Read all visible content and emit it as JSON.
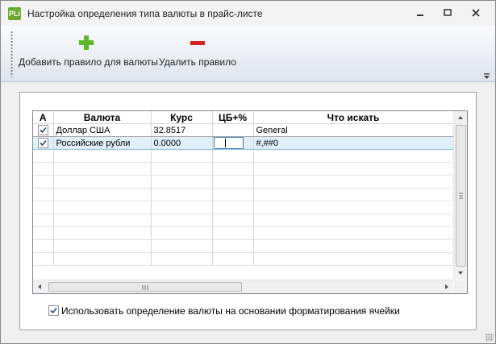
{
  "window": {
    "title": "Настройка определения типа валюты в прайс-листе",
    "icon_text": "PLi"
  },
  "toolbar": {
    "add_label": "Добавить правило для валюты",
    "delete_label": "Удалить правило"
  },
  "grid": {
    "columns": [
      "А",
      "Валюта",
      "Курс",
      "ЦБ+%",
      "Что искать"
    ],
    "rows": [
      {
        "checked": true,
        "currency": "Доллар США",
        "rate": "32.8517",
        "cb": "",
        "search": "General"
      },
      {
        "checked": true,
        "currency": "Российские рубли",
        "rate": "0.0000",
        "cb": "",
        "search": "#,##0"
      }
    ],
    "empty_rows": 9
  },
  "option": {
    "label": "Использовать определение валюты на основании форматирования ячейки",
    "checked": true
  },
  "colors": {
    "add_icon": "#5cb82a",
    "delete_icon": "#d61f1f",
    "selection": "#dff0fb"
  }
}
